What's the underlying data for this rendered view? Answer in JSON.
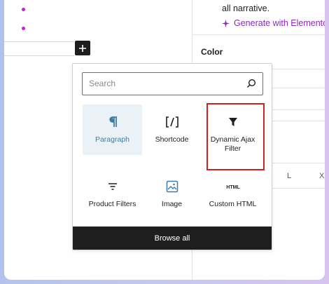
{
  "right_panel": {
    "narrative_text": "all narrative.",
    "generate_label": "Generate with Elementor AI",
    "color_label": "Color",
    "size_options": [
      "L",
      "X"
    ]
  },
  "inserter": {
    "search_placeholder": "Search",
    "blocks": [
      {
        "label": "Paragraph",
        "icon": "paragraph-icon",
        "active": true
      },
      {
        "label": "Shortcode",
        "icon": "shortcode-icon"
      },
      {
        "label": "Dynamic Ajax\nFilter",
        "icon": "funnel-icon",
        "highlighted": true
      },
      {
        "label": "Product Filters",
        "icon": "filter-lines-icon"
      },
      {
        "label": "Image",
        "icon": "image-icon"
      },
      {
        "label": "Custom HTML",
        "icon": "html-icon"
      }
    ],
    "browse_all_label": "Browse all"
  },
  "colors": {
    "accent": "#3a7ea8",
    "ai_purple": "#8a2bbd",
    "highlight_red": "#d02020",
    "dark": "#1e1e1e"
  }
}
